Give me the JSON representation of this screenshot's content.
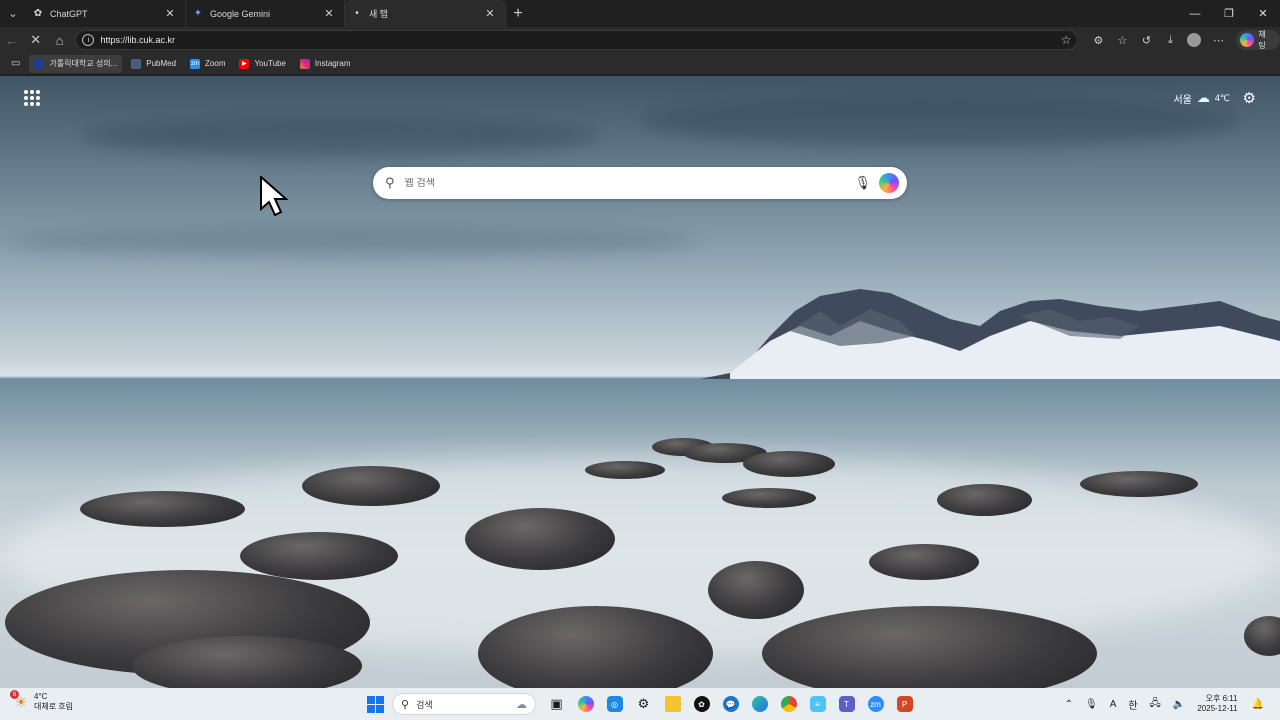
{
  "browser": {
    "tabs": [
      {
        "title": "ChatGPT",
        "icon": "chatgpt-icon"
      },
      {
        "title": "Google Gemini",
        "icon": "gemini-icon"
      },
      {
        "title": "새 탭",
        "icon": "loading-dot"
      }
    ],
    "address": {
      "url": "https://lib.cuk.ac.kr"
    },
    "chat_button": "채팅",
    "favorites": [
      {
        "label": "가톨릭대학교 성의...",
        "color": "#1f3f8f"
      },
      {
        "label": "PubMed",
        "color": "#4b5d7a"
      },
      {
        "label": "Zoom",
        "color": "#2d8cff"
      },
      {
        "label": "YouTube",
        "color": "#ff0000"
      },
      {
        "label": "Instagram",
        "color": "#d62976"
      }
    ]
  },
  "newtab": {
    "weather": {
      "city": "서울",
      "temp": "4℃"
    },
    "search": {
      "placeholder": "웹 검색"
    }
  },
  "taskbar": {
    "weather": {
      "temp": "4°C",
      "condition": "대체로 흐림",
      "badge": "6"
    },
    "search_placeholder": "검색",
    "tray": {
      "lang": "A",
      "ime": "한"
    },
    "clock": {
      "time": "오후 6:11",
      "date": "2025-12-11"
    }
  }
}
